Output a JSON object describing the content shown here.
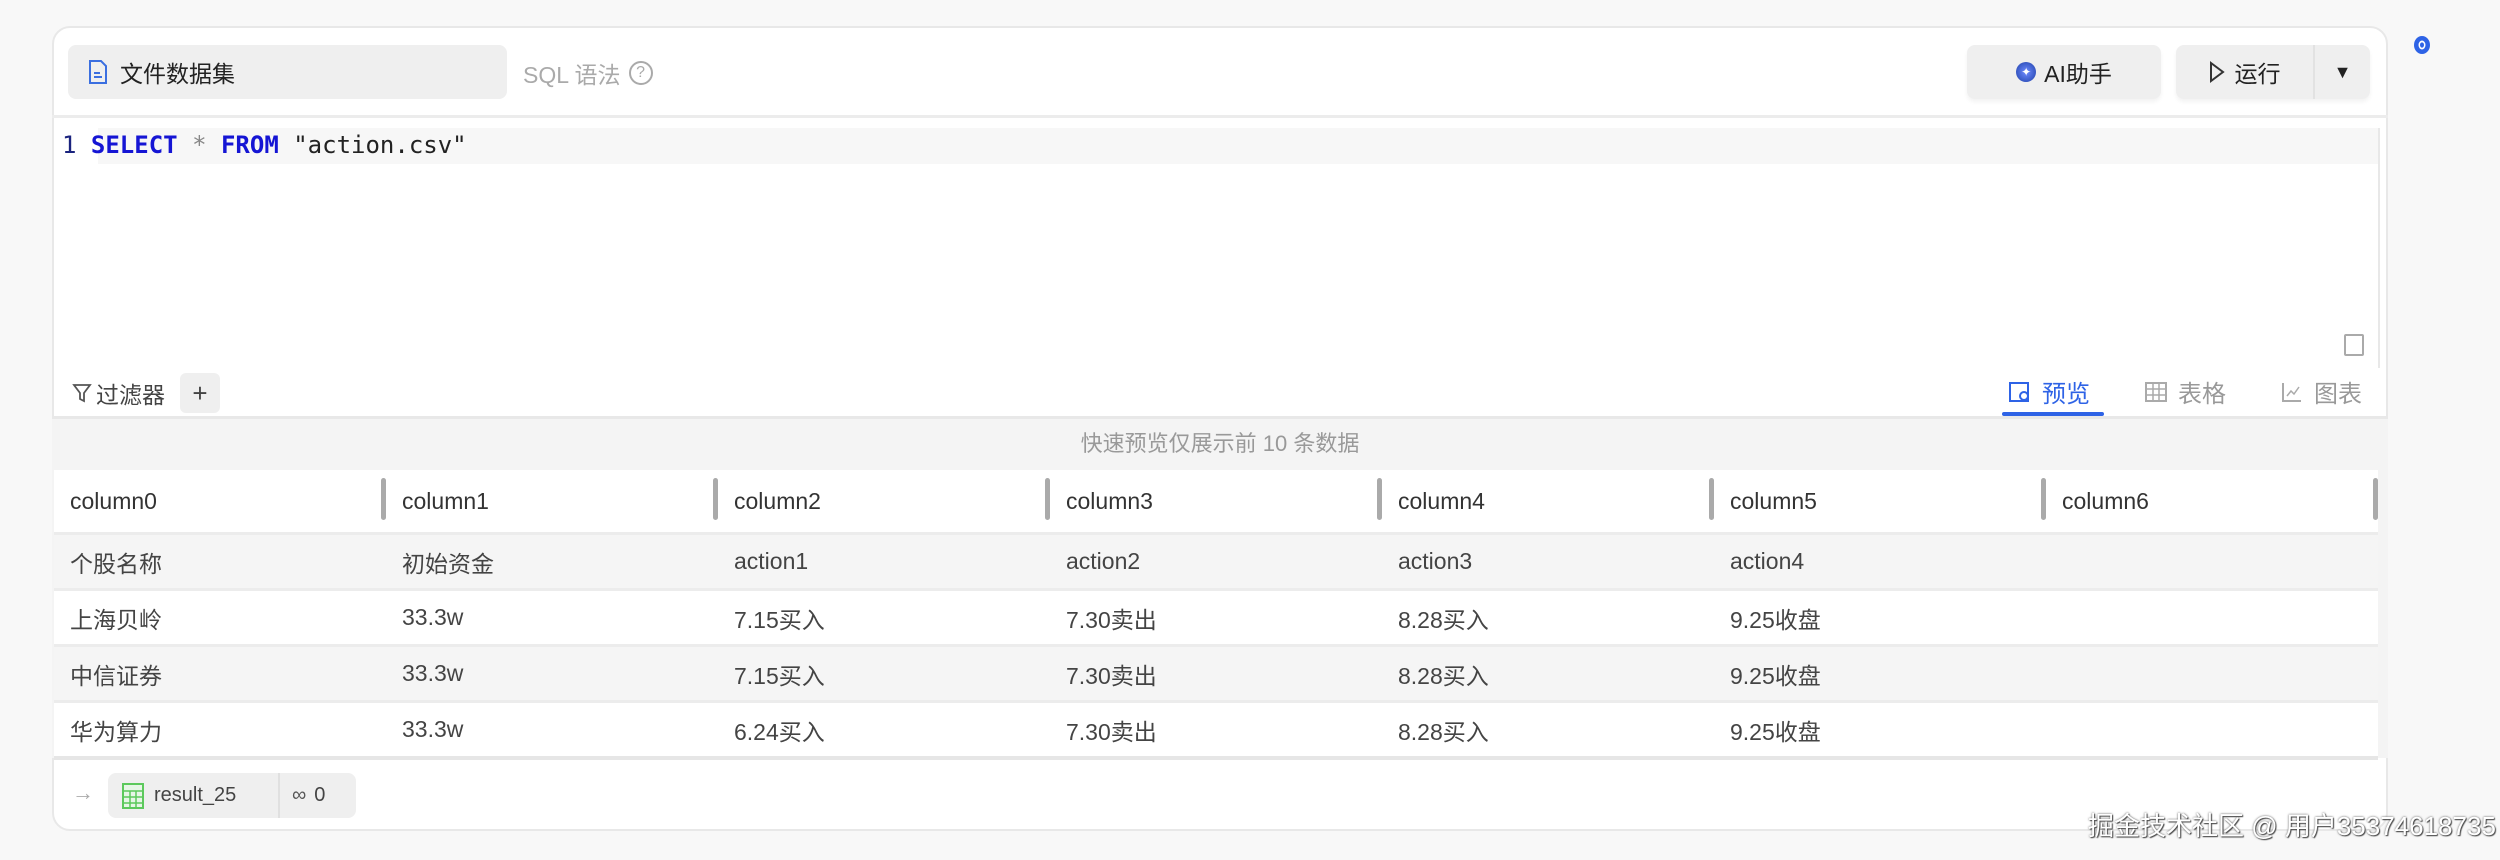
{
  "header": {
    "dataset_label": "文件数据集",
    "sql_syntax_label": "SQL 语法",
    "help_glyph": "?",
    "ai_button": "AI助手",
    "run_button": "运行"
  },
  "editor": {
    "line_number": "1",
    "keyword_select": "SELECT",
    "operator": "*",
    "keyword_from": "FROM",
    "table_string": "\"action.csv\""
  },
  "toolbar": {
    "filter_label": "过滤器",
    "add_filter": "+",
    "tabs": [
      {
        "label": "预览",
        "active": true
      },
      {
        "label": "表格",
        "active": false
      },
      {
        "label": "图表",
        "active": false
      }
    ]
  },
  "table": {
    "info": "快速预览仅展示前 10 条数据",
    "columns": [
      "column0",
      "column1",
      "column2",
      "column3",
      "column4",
      "column5",
      "column6"
    ],
    "rows": [
      [
        "个股名称",
        "初始资金",
        "action1",
        "action2",
        "action3",
        "action4",
        ""
      ],
      [
        "上海贝岭",
        "33.3w",
        "7.15买入",
        "7.30卖出",
        "8.28买入",
        "9.25收盘",
        ""
      ],
      [
        "中信证券",
        "33.3w",
        "7.15买入",
        "7.30卖出",
        "8.28买入",
        "9.25收盘",
        ""
      ],
      [
        "华为算力",
        "33.3w",
        "6.24买入",
        "7.30卖出",
        "8.28买入",
        "9.25收盘",
        ""
      ]
    ]
  },
  "footer": {
    "arrow": "→",
    "result_name": "result_25",
    "link_count": "0"
  },
  "watermark": "掘金技术社区 @ 用户35374618735",
  "colors": {
    "accent": "#2e63e6",
    "keyword": "#1515d4",
    "table_icon": "#5cc95c"
  }
}
